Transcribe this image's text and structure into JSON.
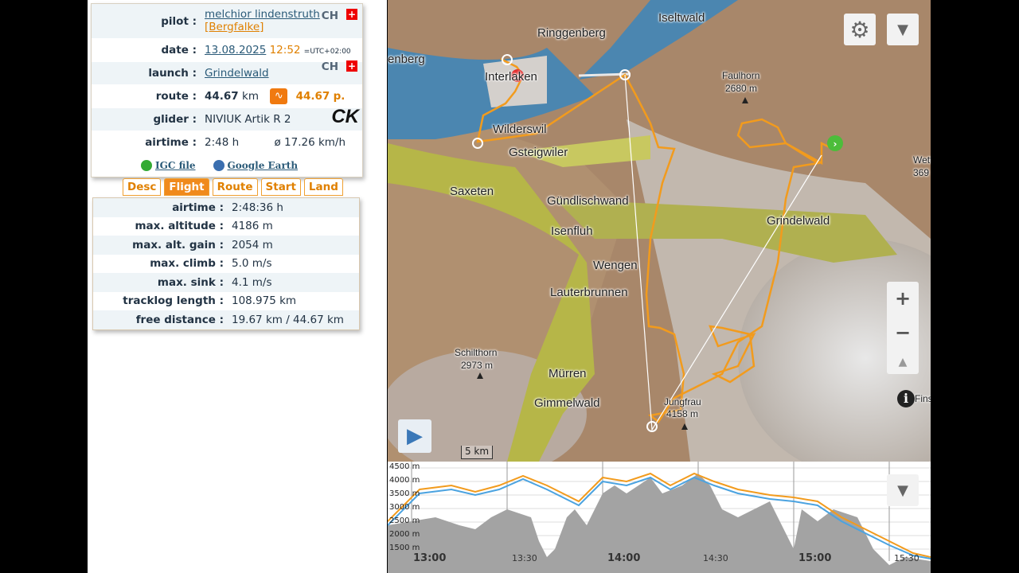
{
  "info": {
    "pilot_label": "pilot :",
    "pilot_name": "melchior lindenstruth",
    "pilot_team": "[Bergfalke]",
    "pilot_country": "CH",
    "date_label": "date :",
    "date": "13.08.2025",
    "time": "12:52",
    "tz": "=UTC+02:00",
    "launch_label": "launch :",
    "launch": "Grindelwald",
    "launch_country": "CH",
    "route_label": "route :",
    "route_km": "44.67",
    "route_unit": "km",
    "route_points": "44.67",
    "route_points_unit": "p.",
    "glider_label": "glider :",
    "glider": "NIVIUK Artik R 2",
    "glider_logo": "CK",
    "airtime_label": "airtime :",
    "airtime": "2:48 h",
    "avg_speed": "ø 17.26 km/h",
    "igc_label": "IGC file",
    "ge_label": "Google Earth"
  },
  "tabs": [
    "Desc",
    "Flight",
    "Route",
    "Start",
    "Land"
  ],
  "active_tab": "Flight",
  "stats": [
    {
      "label": "airtime :",
      "value": "2:48:36 h"
    },
    {
      "label": "max. altitude :",
      "value": "4186 m"
    },
    {
      "label": "max. alt. gain :",
      "value": "2054 m"
    },
    {
      "label": "max. climb :",
      "value": "5.0 m/s"
    },
    {
      "label": "max. sink :",
      "value": "4.1 m/s"
    },
    {
      "label": "tracklog length :",
      "value": "108.975 km"
    },
    {
      "label": "free distance :",
      "value": "19.67 km / 44.67 km"
    }
  ],
  "map": {
    "labels": [
      "Iseltwald",
      "Ringgenberg",
      "enberg",
      "Interlaken",
      "Faulhorn",
      "2680 m",
      "Wilderswil",
      "Gsteigwiler",
      "Wette",
      "369",
      "Saxeten",
      "Gündlischwand",
      "Grindelwald",
      "Isenfluh",
      "Wengen",
      "Lauterbrunnen",
      "Schilthorn",
      "2973 m",
      "Mürren",
      "Gimmelwald",
      "Jungfrau",
      "4158 m",
      "Fins"
    ],
    "scale": "5 km",
    "zoom_in": "+",
    "zoom_out": "−"
  },
  "profile": {
    "y_labels": [
      "4500 m",
      "4000 m",
      "3500 m",
      "3000 m",
      "2500 m",
      "2000 m",
      "1500 m"
    ],
    "x_labels": [
      "13:00",
      "13:30",
      "14:00",
      "14:30",
      "15:00",
      "15:30"
    ],
    "colors": {
      "track": "#f29b1d",
      "gnd": "#4ba3e0"
    }
  }
}
